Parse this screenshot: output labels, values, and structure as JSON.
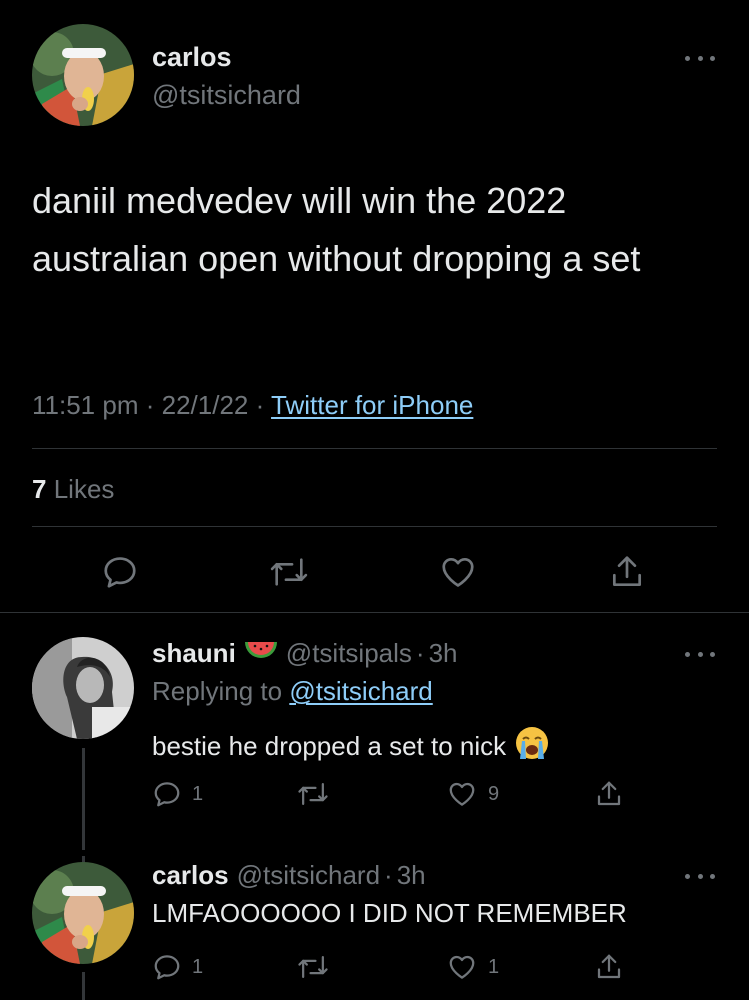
{
  "main_tweet": {
    "name": "carlos",
    "handle": "@tsitsichard",
    "text": "daniil medvedev will win the 2022 australian open without dropping a set",
    "time": "11:51 pm",
    "date": "22/1/22",
    "source": "Twitter for iPhone",
    "likes_count": "7",
    "likes_label": "Likes"
  },
  "replies": [
    {
      "name": "shauni",
      "name_emoji": "watermelon-emoji",
      "handle": "@tsitsipals",
      "age": "3h",
      "replying_to_label": "Replying to",
      "replying_to_handle": "@tsitsichard",
      "text": "bestie he dropped a set to nick",
      "text_emoji": "crying-face-emoji",
      "reply_count": "1",
      "retweet_count": "",
      "like_count": "9"
    },
    {
      "name": "carlos",
      "handle": "@tsitsichard",
      "age": "3h",
      "text": "LMFAOOOOOO I DID NOT REMEMBER",
      "reply_count": "1",
      "retweet_count": "",
      "like_count": "1"
    }
  ],
  "separator": "·",
  "colors": {
    "background": "#000000",
    "text": "#e7e9ea",
    "muted": "#71767b",
    "link": "#8ecdf8",
    "divider": "#2f3336"
  }
}
